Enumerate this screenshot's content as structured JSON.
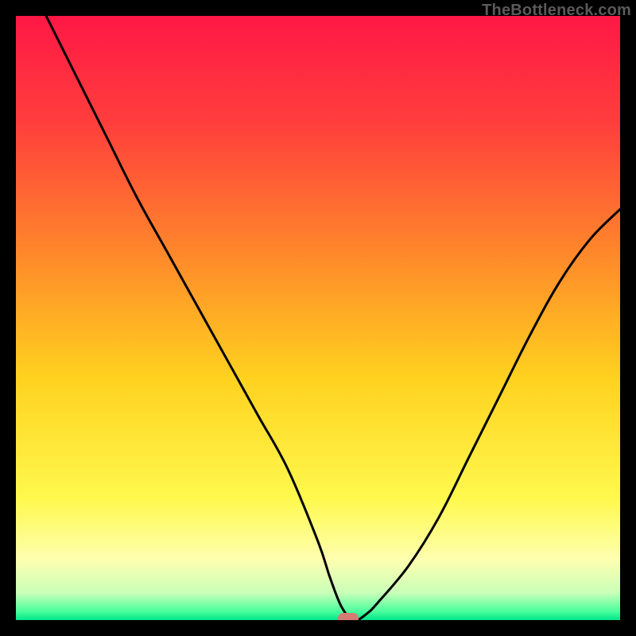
{
  "attribution": "TheBottleneck.com",
  "colors": {
    "frame": "#000000",
    "marker": "#d47b74",
    "curve": "#000000",
    "gradient_stops": [
      {
        "offset": 0.0,
        "color": "#ff1846"
      },
      {
        "offset": 0.18,
        "color": "#ff3f3c"
      },
      {
        "offset": 0.4,
        "color": "#ff8a2a"
      },
      {
        "offset": 0.6,
        "color": "#ffd21f"
      },
      {
        "offset": 0.8,
        "color": "#fff94e"
      },
      {
        "offset": 0.9,
        "color": "#feffb0"
      },
      {
        "offset": 0.955,
        "color": "#c9ffb8"
      },
      {
        "offset": 0.985,
        "color": "#4dff9e"
      },
      {
        "offset": 1.0,
        "color": "#00e589"
      }
    ]
  },
  "chart_data": {
    "type": "line",
    "title": "",
    "xlabel": "",
    "ylabel": "",
    "xlim": [
      0,
      100
    ],
    "ylim": [
      0,
      100
    ],
    "grid": false,
    "legend": false,
    "annotations": [
      "TheBottleneck.com"
    ],
    "marker": {
      "x": 55,
      "y": 0,
      "width_pct": 3.4,
      "height_pct": 1.8
    },
    "series": [
      {
        "name": "bottleneck-curve",
        "x": [
          5,
          10,
          15,
          20,
          25,
          30,
          35,
          40,
          45,
          50,
          52,
          54,
          56,
          58,
          60,
          65,
          70,
          75,
          80,
          85,
          90,
          95,
          100
        ],
        "y": [
          100,
          90,
          80,
          70,
          61,
          52,
          43,
          34,
          25,
          13,
          7,
          2,
          0,
          1,
          3,
          9,
          17,
          27,
          37,
          47,
          56,
          63,
          68
        ]
      }
    ]
  }
}
